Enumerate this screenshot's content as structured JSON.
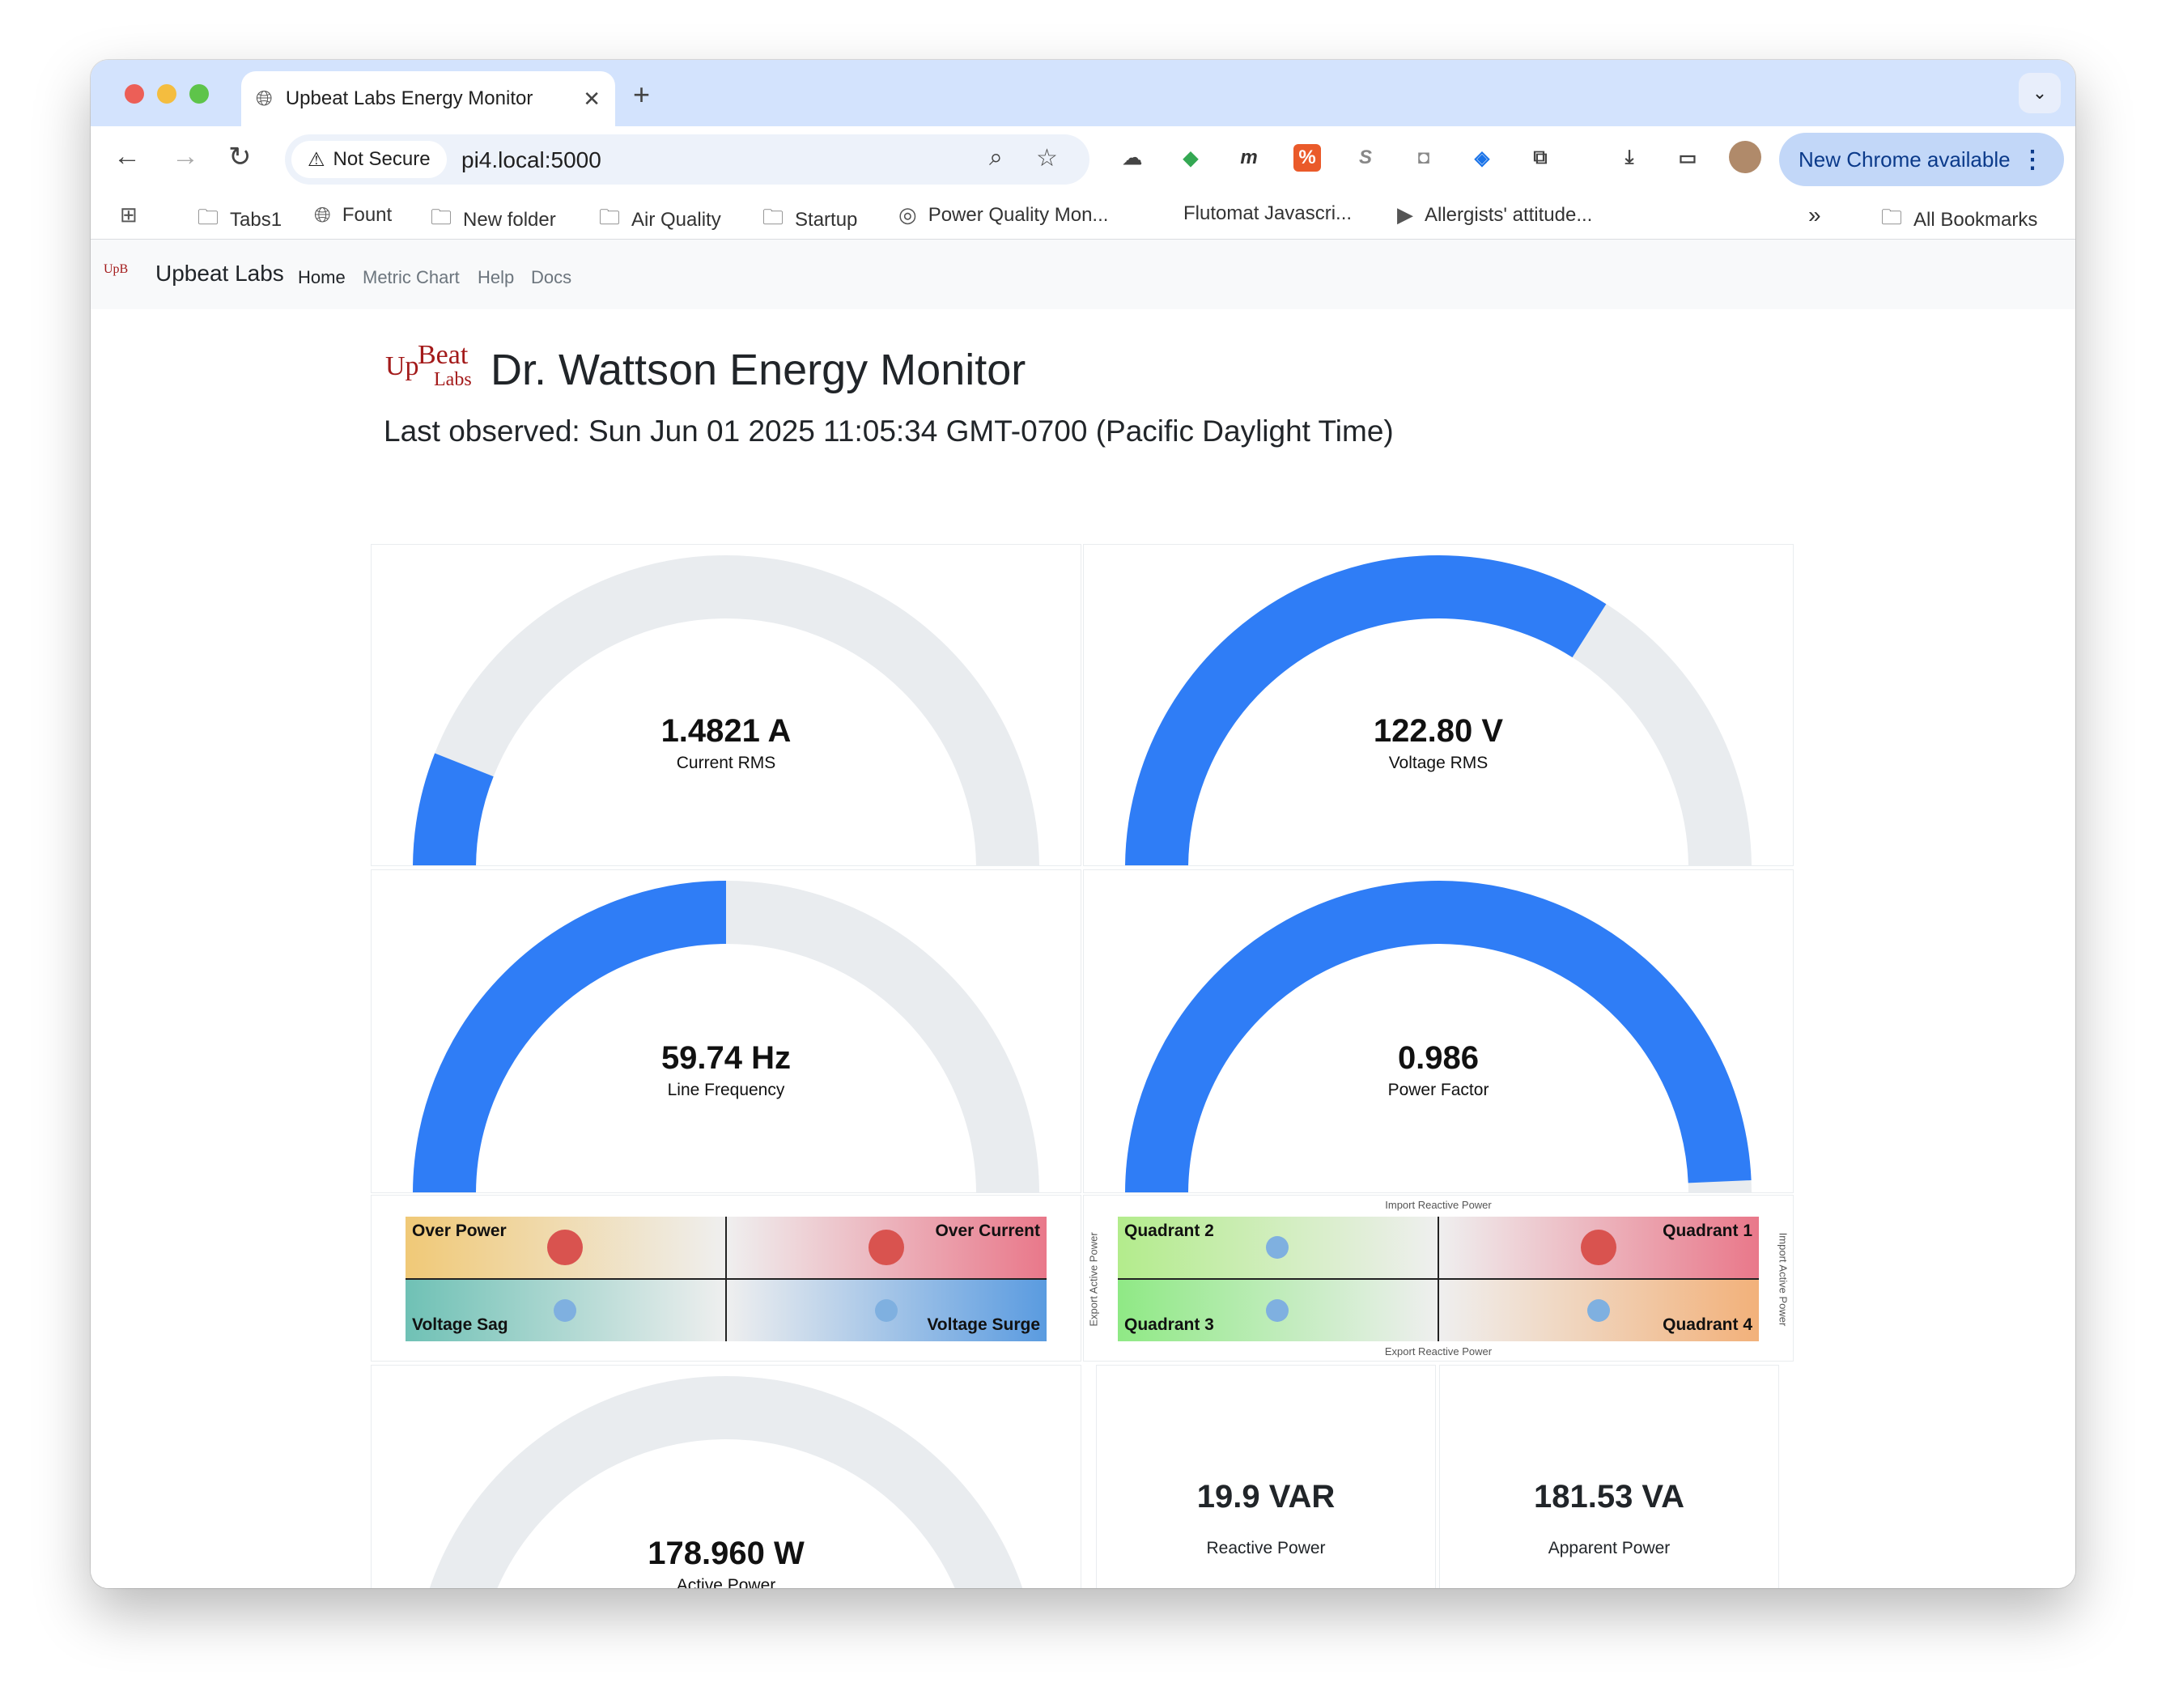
{
  "browser": {
    "tab_title": "Upbeat Labs Energy Monitor",
    "not_secure": "Not Secure",
    "url": "pi4.local:5000",
    "update_button": "New Chrome available",
    "bookmarks": [
      "Tabs1",
      "Fount",
      "New folder",
      "Air Quality",
      "Startup",
      "Power Quality Mon...",
      "Flutomat Javascri...",
      "Allergists' attitude..."
    ],
    "all_bookmarks": "All Bookmarks",
    "overflow": "»"
  },
  "app": {
    "brand": "Upbeat Labs",
    "nav": [
      "Home",
      "Metric Chart",
      "Help",
      "Docs"
    ],
    "title": "Dr. Wattson Energy Monitor",
    "last_observed": "Last observed: Sun Jun 01 2025 11:05:34 GMT-0700 (Pacific Daylight Time)",
    "logo_text": "UpBeat Labs"
  },
  "gauges": [
    {
      "value": "1.4821 A",
      "label": "Current RMS",
      "fill_fraction": 0.12
    },
    {
      "value": "122.80 V",
      "label": "Voltage RMS",
      "fill_fraction": 0.68
    },
    {
      "value": "59.74 Hz",
      "label": "Line Frequency",
      "fill_fraction": 0.5
    },
    {
      "value": "0.986",
      "label": "Power Factor",
      "fill_fraction": 0.986
    },
    {
      "value": "178.960 W",
      "label": "Active Power",
      "fill_fraction": 0.1
    }
  ],
  "quadrant_left": {
    "top_left": "Over Power",
    "top_right": "Over Current",
    "bottom_left": "Voltage Sag",
    "bottom_right": "Voltage Surge"
  },
  "quadrant_right": {
    "top_left": "Quadrant 2",
    "top_right": "Quadrant 1",
    "bottom_left": "Quadrant 3",
    "bottom_right": "Quadrant 4",
    "top_axis": "Import Reactive Power",
    "bottom_axis": "Export Reactive Power",
    "left_axis": "Export Active Power",
    "right_axis": "Import Active Power"
  },
  "stats": [
    {
      "value": "19.9 VAR",
      "label": "Reactive Power"
    },
    {
      "value": "181.53 VA",
      "label": "Apparent Power"
    }
  ],
  "colors": {
    "gauge_fill": "#2f7df6",
    "gauge_track": "#e9ecef",
    "alert_dot": "#d9534f",
    "ok_dot": "#7fb0e0"
  }
}
